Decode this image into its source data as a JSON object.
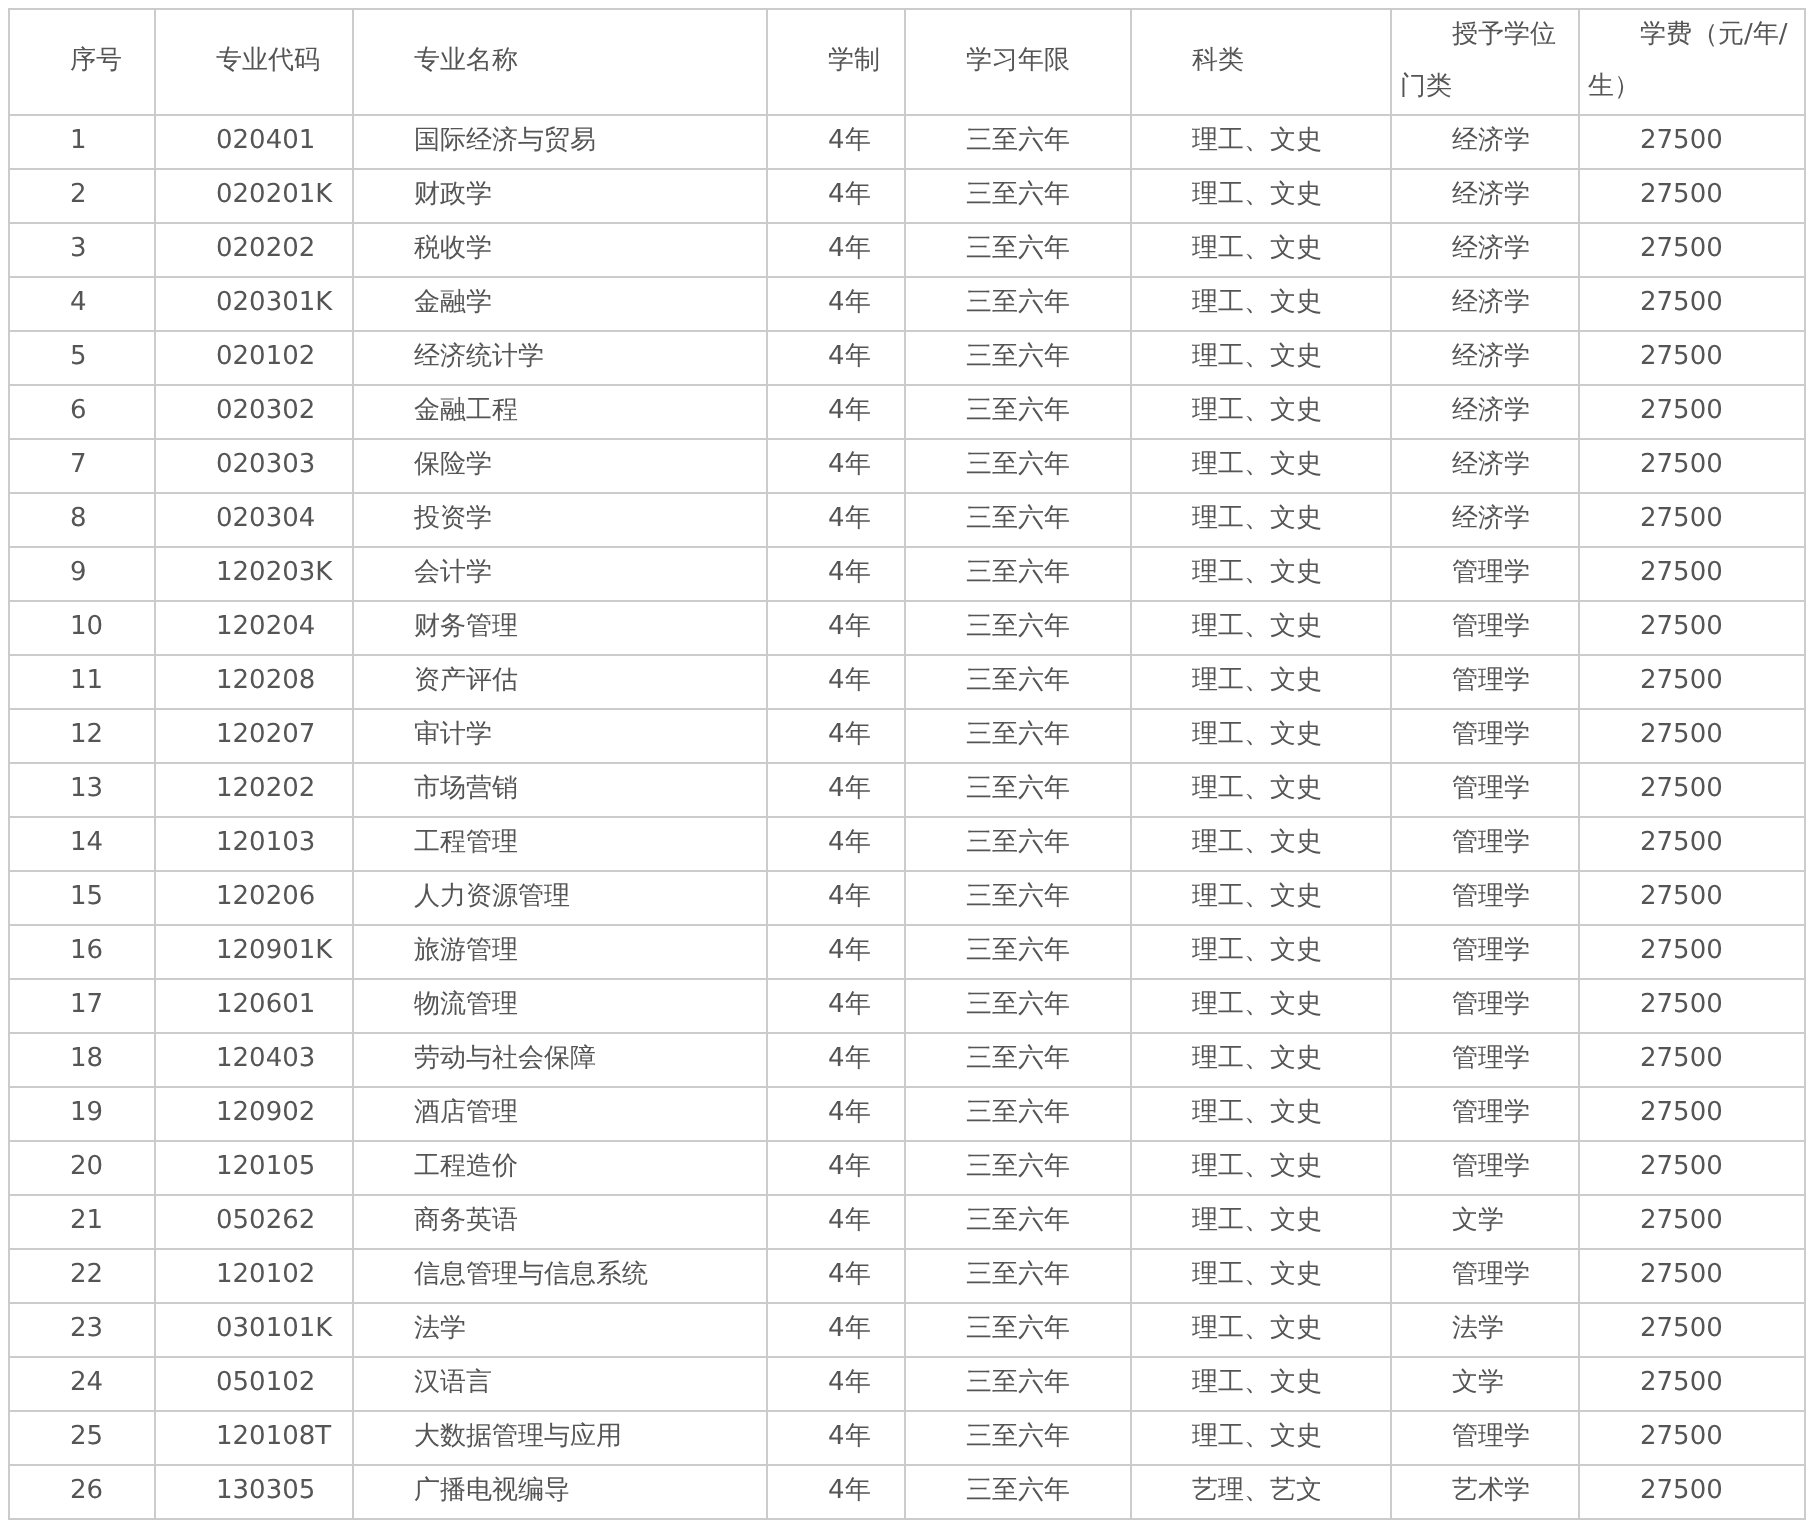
{
  "table": {
    "columns": [
      "序号",
      "专业代码",
      "专业名称",
      "学制",
      "学习年限",
      "科类",
      "授予学位门类",
      "学费（元/年/生）"
    ],
    "rows": [
      [
        "1",
        "020401",
        "国际经济与贸易",
        "4年",
        "三至六年",
        "理工、文史",
        "经济学",
        "27500"
      ],
      [
        "2",
        "020201K",
        "财政学",
        "4年",
        "三至六年",
        "理工、文史",
        "经济学",
        "27500"
      ],
      [
        "3",
        "020202",
        "税收学",
        "4年",
        "三至六年",
        "理工、文史",
        "经济学",
        "27500"
      ],
      [
        "4",
        "020301K",
        "金融学",
        "4年",
        "三至六年",
        "理工、文史",
        "经济学",
        "27500"
      ],
      [
        "5",
        "020102",
        "经济统计学",
        "4年",
        "三至六年",
        "理工、文史",
        "经济学",
        "27500"
      ],
      [
        "6",
        "020302",
        "金融工程",
        "4年",
        "三至六年",
        "理工、文史",
        "经济学",
        "27500"
      ],
      [
        "7",
        "020303",
        "保险学",
        "4年",
        "三至六年",
        "理工、文史",
        "经济学",
        "27500"
      ],
      [
        "8",
        "020304",
        "投资学",
        "4年",
        "三至六年",
        "理工、文史",
        "经济学",
        "27500"
      ],
      [
        "9",
        "120203K",
        "会计学",
        "4年",
        "三至六年",
        "理工、文史",
        "管理学",
        "27500"
      ],
      [
        "10",
        "120204",
        "财务管理",
        "4年",
        "三至六年",
        "理工、文史",
        "管理学",
        "27500"
      ],
      [
        "11",
        "120208",
        "资产评估",
        "4年",
        "三至六年",
        "理工、文史",
        "管理学",
        "27500"
      ],
      [
        "12",
        "120207",
        "审计学",
        "4年",
        "三至六年",
        "理工、文史",
        "管理学",
        "27500"
      ],
      [
        "13",
        "120202",
        "市场营销",
        "4年",
        "三至六年",
        "理工、文史",
        "管理学",
        "27500"
      ],
      [
        "14",
        "120103",
        "工程管理",
        "4年",
        "三至六年",
        "理工、文史",
        "管理学",
        "27500"
      ],
      [
        "15",
        "120206",
        "人力资源管理",
        "4年",
        "三至六年",
        "理工、文史",
        "管理学",
        "27500"
      ],
      [
        "16",
        "120901K",
        "旅游管理",
        "4年",
        "三至六年",
        "理工、文史",
        "管理学",
        "27500"
      ],
      [
        "17",
        "120601",
        "物流管理",
        "4年",
        "三至六年",
        "理工、文史",
        "管理学",
        "27500"
      ],
      [
        "18",
        "120403",
        "劳动与社会保障",
        "4年",
        "三至六年",
        "理工、文史",
        "管理学",
        "27500"
      ],
      [
        "19",
        "120902",
        "酒店管理",
        "4年",
        "三至六年",
        "理工、文史",
        "管理学",
        "27500"
      ],
      [
        "20",
        "120105",
        "工程造价",
        "4年",
        "三至六年",
        "理工、文史",
        "管理学",
        "27500"
      ],
      [
        "21",
        "050262",
        "商务英语",
        "4年",
        "三至六年",
        "理工、文史",
        "文学",
        "27500"
      ],
      [
        "22",
        "120102",
        "信息管理与信息系统",
        "4年",
        "三至六年",
        "理工、文史",
        "管理学",
        "27500"
      ],
      [
        "23",
        "030101K",
        "法学",
        "4年",
        "三至六年",
        "理工、文史",
        "法学",
        "27500"
      ],
      [
        "24",
        "050102",
        "汉语言",
        "4年",
        "三至六年",
        "理工、文史",
        "文学",
        "27500"
      ],
      [
        "25",
        "120108T",
        "大数据管理与应用",
        "4年",
        "三至六年",
        "理工、文史",
        "管理学",
        "27500"
      ],
      [
        "26",
        "130305",
        "广播电视编导",
        "4年",
        "三至六年",
        "艺理、艺文",
        "艺术学",
        "27500"
      ]
    ]
  }
}
